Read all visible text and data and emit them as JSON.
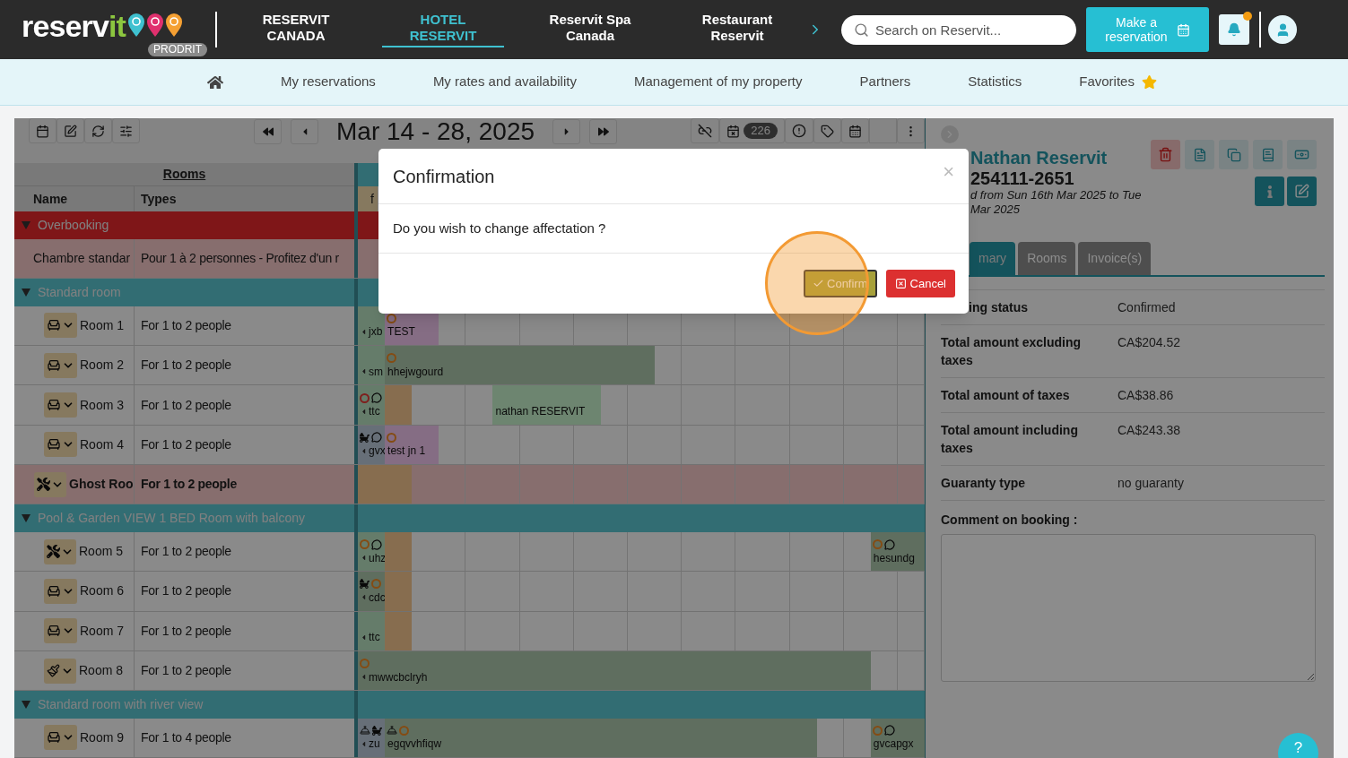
{
  "header": {
    "logo": {
      "word": "reserv",
      "accent": "it",
      "badge": "PRODRIT"
    },
    "nav": [
      {
        "label": "RESERVIT\nCANADA",
        "selected": false
      },
      {
        "label": "HOTEL\nRESERVIT",
        "selected": true
      },
      {
        "label": "Reservit Spa\nCanada",
        "selected": false
      },
      {
        "label": "Restaurant\nReservit",
        "selected": false
      }
    ],
    "search": {
      "placeholder": "Search on Reservit..."
    },
    "reserve_button": "Make a\nreservation",
    "notifications": {
      "unread": true
    }
  },
  "subnav": [
    {
      "label": "My reservations"
    },
    {
      "label": "My rates and availability"
    },
    {
      "label": "Management of my property"
    },
    {
      "label": "Partners"
    },
    {
      "label": "Statistics"
    },
    {
      "label": "Favorites",
      "starred": true
    }
  ],
  "planning": {
    "date_range": "Mar 14 - 28, 2025",
    "unassigned_count": "226",
    "rooms_heading": "Rooms",
    "columns": [
      "Name",
      "Types"
    ],
    "first_day": "f",
    "rows": [
      {
        "kind": "group",
        "label": "Overbooking",
        "alert": true,
        "expanded": true
      },
      {
        "kind": "room",
        "name": "Chambre standar",
        "type": "Pour 1 à 2 personnes - Profitez d'un r",
        "alert": true,
        "ghost": false,
        "bookings": []
      },
      {
        "kind": "group",
        "label": "Standard room",
        "alert": false,
        "expanded": true
      },
      {
        "kind": "room",
        "name": "Room 1",
        "type": "For 1 to 2 people",
        "chip": {
          "kind": "to_clean"
        },
        "alert": false,
        "ghost": false,
        "bookings": [
          {
            "label": "jxb",
            "kind": "arrived",
            "continues_before": true
          },
          {
            "label": "TEST",
            "kind": "option",
            "markers": [
              {
                "kind": "pending"
              }
            ]
          }
        ]
      },
      {
        "kind": "room",
        "name": "Room 2",
        "type": "For 1 to 2 people",
        "chip": {
          "kind": "to_clean"
        },
        "alert": false,
        "ghost": false,
        "bookings": [
          {
            "label": "sm",
            "kind": "arrived",
            "continues_before": true
          },
          {
            "label": "hhejwgourd",
            "kind": "confirmed",
            "markers": [
              {
                "kind": "pending"
              }
            ]
          }
        ]
      },
      {
        "kind": "room",
        "name": "Room 3",
        "type": "For 1 to 2 people",
        "chip": {
          "kind": "to_clean"
        },
        "alert": false,
        "ghost": false,
        "bookings": [
          {
            "label": "ttc",
            "kind": "arrived",
            "continues_before": true,
            "markers": [
              {
                "kind": "unpaid"
              },
              {
                "kind": "comment"
              }
            ]
          },
          {
            "kind": "closed"
          },
          {
            "label": "nathan RESERVIT",
            "kind": "current"
          }
        ]
      },
      {
        "kind": "room",
        "name": "Room 4",
        "type": "For 1 to 2 people",
        "chip": {
          "kind": "to_clean"
        },
        "alert": false,
        "ghost": false,
        "bookings": [
          {
            "label": "gvx",
            "kind": "departed",
            "continues_before": true,
            "markers": [
              {
                "kind": "child"
              },
              {
                "kind": "comment"
              }
            ]
          },
          {
            "label": "test jn 1",
            "kind": "option",
            "markers": [
              {
                "kind": "pending"
              }
            ]
          }
        ]
      },
      {
        "kind": "room",
        "name": "Ghost Roo",
        "type": "For 1 to 2 people",
        "chip": {
          "kind": "maintenance"
        },
        "alert": true,
        "ghost": true,
        "bookings": [
          {
            "kind": "closed"
          }
        ]
      },
      {
        "kind": "group",
        "label": "Pool & Garden VIEW 1 BED Room with balcony",
        "alert": false,
        "expanded": true
      },
      {
        "kind": "room",
        "name": "Room 5",
        "type": "For 1 to 2 people",
        "chip": {
          "kind": "maintenance"
        },
        "alert": false,
        "ghost": false,
        "bookings": [
          {
            "label": "uhz",
            "kind": "arrived",
            "continues_before": true,
            "markers": [
              {
                "kind": "pending"
              },
              {
                "kind": "comment"
              }
            ]
          },
          {
            "kind": "closed"
          },
          {
            "label": "hesundg",
            "kind": "confirmed",
            "markers": [
              {
                "kind": "pending"
              },
              {
                "kind": "comment"
              }
            ]
          }
        ]
      },
      {
        "kind": "room",
        "name": "Room 6",
        "type": "For 1 to 2 people",
        "chip": {
          "kind": "to_clean"
        },
        "alert": false,
        "ghost": false,
        "bookings": [
          {
            "label": "cdc",
            "kind": "confirmed",
            "continues_before": true,
            "markers": [
              {
                "kind": "child"
              },
              {
                "kind": "pending"
              }
            ]
          },
          {
            "kind": "closed"
          }
        ]
      },
      {
        "kind": "room",
        "name": "Room 7",
        "type": "For 1 to 2 people",
        "chip": {
          "kind": "to_clean"
        },
        "alert": false,
        "ghost": false,
        "bookings": [
          {
            "label": "ttc",
            "kind": "arrived",
            "continues_before": true
          },
          {
            "kind": "closed"
          }
        ]
      },
      {
        "kind": "room",
        "name": "Room 8",
        "type": "For 1 to 2 people",
        "chip": {
          "kind": "cleaning"
        },
        "alert": false,
        "ghost": false,
        "bookings": [
          {
            "label": "mwwcbclryh",
            "kind": "confirmed",
            "continues_before": true,
            "markers": [
              {
                "kind": "pending"
              }
            ]
          }
        ]
      },
      {
        "kind": "group",
        "label": "Standard room with river view",
        "alert": false,
        "expanded": true
      },
      {
        "kind": "room",
        "name": "Room 9",
        "type": "For 1 to 4 people",
        "chip": {
          "kind": "to_clean"
        },
        "alert": false,
        "ghost": false,
        "bookings": [
          {
            "label": "zu",
            "kind": "departed",
            "continues_before": true,
            "markers": [
              {
                "kind": "service"
              },
              {
                "kind": "child"
              }
            ]
          },
          {
            "label": "egqvvhfiqw",
            "kind": "confirmed",
            "markers": [
              {
                "kind": "service"
              },
              {
                "kind": "pending"
              }
            ]
          },
          {
            "label": "gvcapgx",
            "kind": "confirmed",
            "markers": [
              {
                "kind": "pending"
              },
              {
                "kind": "comment"
              }
            ]
          }
        ]
      }
    ]
  },
  "panel": {
    "guest": "Nathan Reservit",
    "number": "254111-2651",
    "stay_lines": [
      "d from Sun 16th Mar 2025 to Tue",
      "Mar 2025"
    ],
    "tabs": [
      {
        "label": "mary",
        "selected": true
      },
      {
        "label": "Rooms",
        "selected": false
      },
      {
        "label": "Invoice(s)",
        "selected": false
      }
    ],
    "details": [
      {
        "label": "ing status",
        "value": "Confirmed"
      },
      {
        "label": "Total amount excluding taxes",
        "value": "CA$204.52"
      },
      {
        "label": "Total amount of taxes",
        "value": "CA$38.86"
      },
      {
        "label": "Total amount including taxes",
        "value": "CA$243.38"
      },
      {
        "label": "Guaranty type",
        "value": "no guaranty"
      }
    ],
    "comment_label": "Comment on booking :"
  },
  "modal": {
    "title": "Confirmation",
    "close": "×",
    "message": "Do you wish to change affectation ?",
    "confirm": "Confirm",
    "cancel": "Cancel",
    "highlighted": true
  },
  "help": "?"
}
